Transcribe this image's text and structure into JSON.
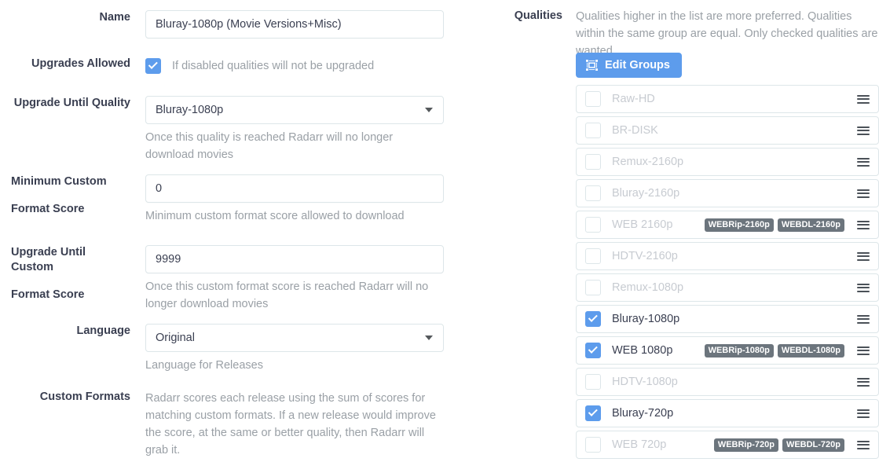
{
  "colors": {
    "accent_blue": "#5d9cec",
    "badge_gray": "#6c757d",
    "label_dark": "#3a3f51",
    "muted_text": "#9aa0a6",
    "disabled_text": "#c7cbd1",
    "border": "#dde6e9"
  },
  "form": {
    "name": {
      "label": "Name",
      "value": "Bluray-1080p (Movie Versions+Misc)",
      "placeholder": ""
    },
    "upgrades_allowed": {
      "label": "Upgrades Allowed",
      "checked": true,
      "help": "If disabled qualities will not be upgraded"
    },
    "upgrade_until_quality": {
      "label": "Upgrade Until Quality",
      "value": "Bluray-1080p",
      "help": "Once this quality is reached Radarr will no longer download movies"
    },
    "minimum_custom_format_score": {
      "label_line1": "Minimum Custom",
      "label_line2": "Format Score",
      "value": "0",
      "help": "Minimum custom format score allowed to download"
    },
    "upgrade_until_custom_format_score": {
      "label_line1": "Upgrade Until Custom",
      "label_line2": "Format Score",
      "value": "9999",
      "help": "Once this custom format score is reached Radarr will no longer download movies"
    },
    "language": {
      "label": "Language",
      "value": "Original",
      "help": "Language for Releases"
    },
    "custom_formats": {
      "label": "Custom Formats",
      "help": "Radarr scores each release using the sum of scores for matching custom formats. If a new release would improve the score, at the same or better quality, then Radarr will grab it."
    }
  },
  "qualities": {
    "label": "Qualities",
    "description": "Qualities higher in the list are more preferred. Qualities within the same group are equal. Only checked qualities are wanted",
    "edit_groups_label": "Edit Groups",
    "edit_groups_icon": "object-group-icon",
    "drag_handle_icon": "drag-handle-icon",
    "items": [
      {
        "name": "Raw-HD",
        "checked": false,
        "badges": []
      },
      {
        "name": "BR-DISK",
        "checked": false,
        "badges": []
      },
      {
        "name": "Remux-2160p",
        "checked": false,
        "badges": []
      },
      {
        "name": "Bluray-2160p",
        "checked": false,
        "badges": []
      },
      {
        "name": "WEB 2160p",
        "checked": false,
        "badges": [
          "WEBRip-2160p",
          "WEBDL-2160p"
        ]
      },
      {
        "name": "HDTV-2160p",
        "checked": false,
        "badges": []
      },
      {
        "name": "Remux-1080p",
        "checked": false,
        "badges": []
      },
      {
        "name": "Bluray-1080p",
        "checked": true,
        "badges": []
      },
      {
        "name": "WEB 1080p",
        "checked": true,
        "badges": [
          "WEBRip-1080p",
          "WEBDL-1080p"
        ]
      },
      {
        "name": "HDTV-1080p",
        "checked": false,
        "badges": []
      },
      {
        "name": "Bluray-720p",
        "checked": true,
        "badges": []
      },
      {
        "name": "WEB 720p",
        "checked": false,
        "badges": [
          "WEBRip-720p",
          "WEBDL-720p"
        ]
      }
    ]
  }
}
